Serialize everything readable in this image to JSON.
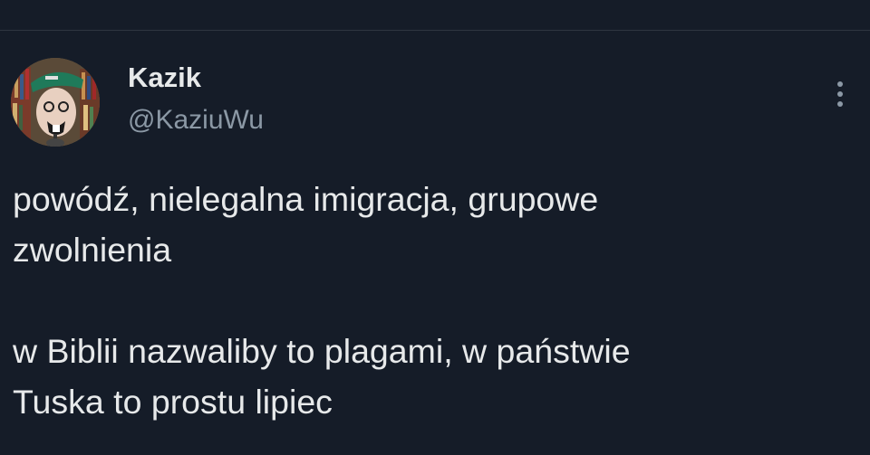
{
  "tweet": {
    "display_name": "Kazik",
    "handle": "@KaziuWu",
    "text": "powódź, nielegalna imigracja, grupowe\nzwolnienia\n\nw Biblii nazwaliby to plagami, w państwie\nTuska to prostu lipiec",
    "more_icon": "vertical-ellipsis-icon"
  },
  "colors": {
    "background": "#151c28",
    "primary_text": "#e7e9ea",
    "secondary_text": "#8b98a5",
    "divider": "#2f3640"
  }
}
